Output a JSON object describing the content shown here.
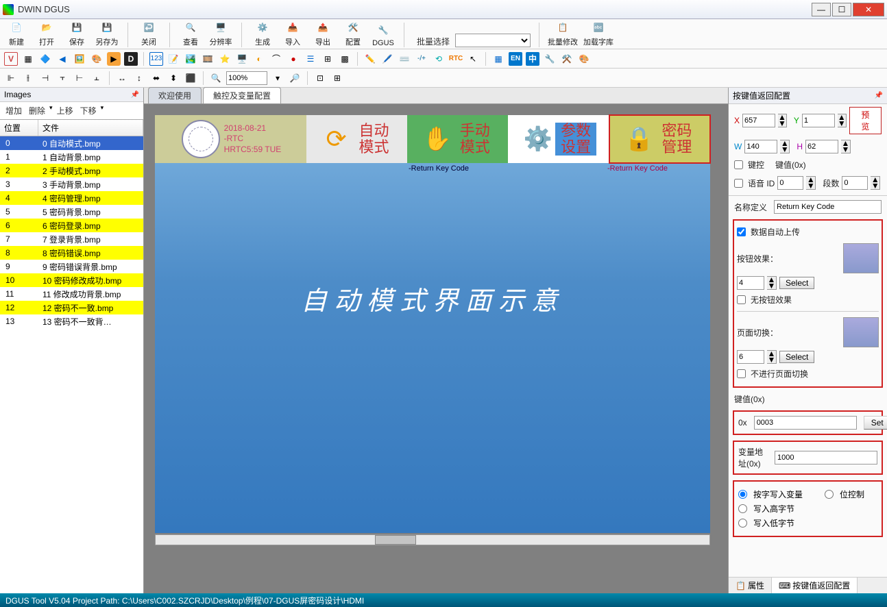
{
  "app": {
    "title": "DWIN DGUS"
  },
  "winbtns": {
    "min": "—",
    "max": "☐",
    "close": "✕"
  },
  "toolbar": {
    "new": "新建",
    "open": "打开",
    "save": "保存",
    "saveAs": "另存为",
    "close": "关闭",
    "view": "查看",
    "resolution": "分辨率",
    "generate": "生成",
    "import": "导入",
    "export": "导出",
    "config": "配置",
    "dgus": "DGUS",
    "batchLabel": "批量选择",
    "batchModify": "批量修改",
    "loadFont": "加载字库"
  },
  "strip2": {
    "rtc": "RTC",
    "en": "EN",
    "zh": "中",
    "hw": "HW"
  },
  "strip3": {
    "zoom": "100%"
  },
  "imagesPanel": {
    "title": "Images",
    "ops": {
      "add": "增加",
      "del": "删除",
      "up": "上移",
      "down": "下移"
    },
    "headers": {
      "pos": "位置",
      "file": "文件"
    },
    "rows": [
      {
        "pos": "0",
        "file": "0 自动模式.bmp",
        "cls": "sel"
      },
      {
        "pos": "1",
        "file": "1 自动背景.bmp",
        "cls": ""
      },
      {
        "pos": "2",
        "file": "2 手动模式.bmp",
        "cls": "yellow"
      },
      {
        "pos": "3",
        "file": "3 手动背景.bmp",
        "cls": ""
      },
      {
        "pos": "4",
        "file": "4 密码管理.bmp",
        "cls": "yellow"
      },
      {
        "pos": "5",
        "file": "5 密码背景.bmp",
        "cls": ""
      },
      {
        "pos": "6",
        "file": "6 密码登录.bmp",
        "cls": "yellow"
      },
      {
        "pos": "7",
        "file": "7 登录背景.bmp",
        "cls": ""
      },
      {
        "pos": "8",
        "file": "8 密码错误.bmp",
        "cls": "yellow"
      },
      {
        "pos": "9",
        "file": "9 密码错误背景.bmp",
        "cls": ""
      },
      {
        "pos": "10",
        "file": "10 密码修改成功.bmp",
        "cls": "yellow"
      },
      {
        "pos": "11",
        "file": "11 修改成功背景.bmp",
        "cls": ""
      },
      {
        "pos": "12",
        "file": "12 密码不一致.bmp",
        "cls": "yellow"
      },
      {
        "pos": "13",
        "file": "13 密码不一致背…",
        "cls": ""
      }
    ]
  },
  "tabs": {
    "welcome": "欢迎使用",
    "touchVar": "触控及变量配置"
  },
  "canvas": {
    "date": "2018-08-21",
    "rtc": "-RTC",
    "time": "HRTC5:59 TUE",
    "autoMode": "自动\n模式",
    "manualMode": "手动\n模式",
    "paramSet": "参数\n设置",
    "pwdMgmt": "密码\n管理",
    "returnKey1": "-Return Key Code",
    "returnKey2": "-Return Key Code",
    "title": "自动模式界面示意"
  },
  "props": {
    "title": "按键值返回配置",
    "x": "X",
    "xv": "657",
    "y": "Y",
    "yv": "1",
    "w": "W",
    "wv": "140",
    "h": "H",
    "hv": "62",
    "preview": "预览",
    "keyCtrl": "键控",
    "keyValLabel": "键值(0x)",
    "voiceId": "语音 ID",
    "voiceIdv": "0",
    "segCount": "段数",
    "segCountv": "0",
    "nameDef": "名称定义",
    "nameDefv": "Return Key Code",
    "autoUpload": "数据自动上传",
    "btnEffect": "按钮效果：",
    "btnEffectv": "4",
    "select": "Select",
    "noBtnEffect": "无按钮效果",
    "pageSwitch": "页面切换：",
    "pageSwitchv": "6",
    "noPageSwitch": "不进行页面切换",
    "keyVal": "键值(0x)",
    "keyHexPre": "0x",
    "keyHexv": "0003",
    "set": "Set",
    "varAddr": "变量地址(0x)",
    "varAddrv": "1000",
    "r1": "按字写入变量",
    "r2": "位控制",
    "r3": "写入高字节",
    "r4": "写入低字节",
    "btab1": "属性",
    "btab2": "按键值返回配置"
  },
  "status": "DGUS Tool V5.04  Project Path: C:\\Users\\C002.SZCRJD\\Desktop\\例程\\07-DGUS屏密码设计\\HDMI"
}
